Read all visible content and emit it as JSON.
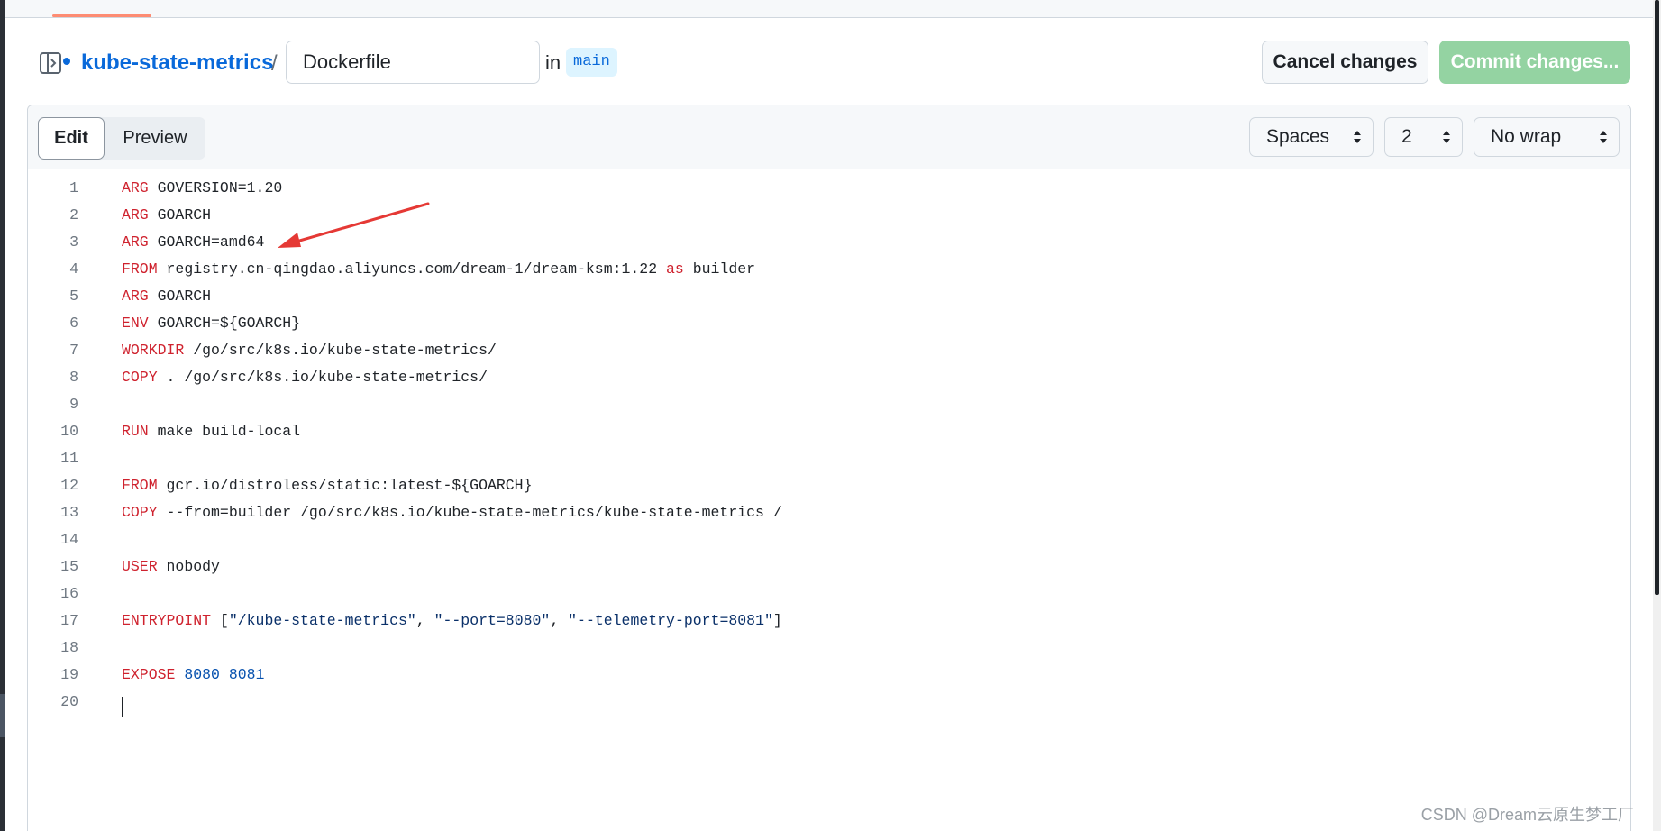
{
  "header": {
    "repo_name": "kube-state-metrics",
    "path_separator": "/",
    "filename_value": "Dockerfile",
    "in_label": "in",
    "branch": "main",
    "cancel_label": "Cancel changes",
    "commit_label": "Commit changes..."
  },
  "editor": {
    "tabs": {
      "edit_label": "Edit",
      "preview_label": "Preview"
    },
    "indent_mode": "Spaces",
    "indent_size": "2",
    "wrap_mode": "No wrap",
    "lines": [
      {
        "n": "1",
        "kw": "ARG",
        "rest": " GOVERSION=1.20"
      },
      {
        "n": "2",
        "kw": "ARG",
        "rest": " GOARCH"
      },
      {
        "n": "3",
        "kw": "ARG",
        "rest": " GOARCH=amd64"
      },
      {
        "n": "4",
        "kw": "FROM",
        "rest": " registry.cn-qingdao.aliyuncs.com/dream-1/dream-ksm:1.22 ",
        "kw2": "as",
        "rest2": " builder"
      },
      {
        "n": "5",
        "kw": "ARG",
        "rest": " GOARCH"
      },
      {
        "n": "6",
        "kw": "ENV",
        "rest": " GOARCH=${GOARCH}"
      },
      {
        "n": "7",
        "kw": "WORKDIR",
        "rest": " /go/src/k8s.io/kube-state-metrics/"
      },
      {
        "n": "8",
        "kw": "COPY",
        "rest": " . /go/src/k8s.io/kube-state-metrics/"
      },
      {
        "n": "9",
        "kw": "",
        "rest": ""
      },
      {
        "n": "10",
        "kw": "RUN",
        "rest": " make build-local"
      },
      {
        "n": "11",
        "kw": "",
        "rest": ""
      },
      {
        "n": "12",
        "kw": "FROM",
        "rest": " gcr.io/distroless/static:latest-${GOARCH}"
      },
      {
        "n": "13",
        "kw": "COPY",
        "rest": " --from=builder /go/src/k8s.io/kube-state-metrics/kube-state-metrics /"
      },
      {
        "n": "14",
        "kw": "",
        "rest": ""
      },
      {
        "n": "15",
        "kw": "USER",
        "rest": " nobody"
      },
      {
        "n": "16",
        "kw": "",
        "rest": ""
      },
      {
        "n": "17",
        "kw": "ENTRYPOINT",
        "rest": " [",
        "str_parts": [
          "\"/kube-state-metrics\"",
          ", ",
          "\"--port=8080\"",
          ", ",
          "\"--telemetry-port=8081\""
        ],
        "rest2": "]"
      },
      {
        "n": "18",
        "kw": "",
        "rest": ""
      },
      {
        "n": "19",
        "kw": "EXPOSE",
        "rest": " ",
        "nums": "8080 8081"
      },
      {
        "n": "20",
        "kw": "",
        "rest": ""
      }
    ]
  },
  "watermark": "CSDN @Dream云原生梦工厂",
  "colors": {
    "keyword": "#cf222e",
    "number": "#0550ae",
    "link": "#0969da",
    "commit_button": "#94d3a2",
    "annotation_arrow": "#e53935"
  },
  "icons": {
    "file_tree": "sidebar-expand-icon",
    "caret": "select-caret-icon"
  }
}
